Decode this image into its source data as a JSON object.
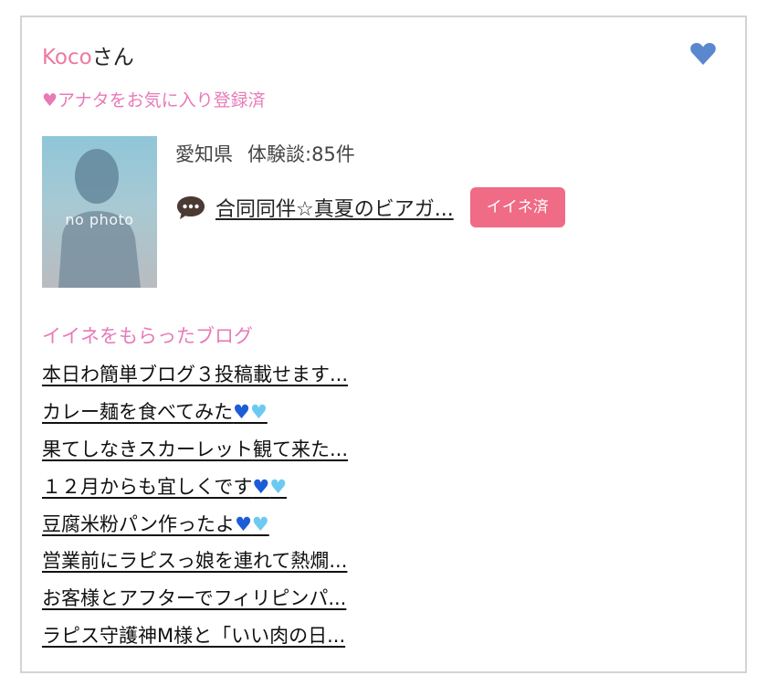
{
  "user": {
    "name": "Koco",
    "honorific": "さん",
    "favorite_status": "♥アナタをお気に入り登録済",
    "avatar_label": "no photo",
    "prefecture": "愛知県",
    "reviews": "体験談:85件"
  },
  "story": {
    "title": "合同同伴☆真夏のビアガ...",
    "like_badge": "イイネ済"
  },
  "blogs": {
    "heading": "イイネをもらったブログ",
    "items": [
      {
        "text": "本日わ簡単ブログ３投稿載せます...",
        "hearts": false
      },
      {
        "text": "カレー麺を食べてみた",
        "hearts": true
      },
      {
        "text": "果てしなきスカーレット観て来た...",
        "hearts": false
      },
      {
        "text": "１２月からも宜しくです",
        "hearts": true
      },
      {
        "text": "豆腐米粉パン作ったよ",
        "hearts": true
      },
      {
        "text": "営業前にラピスっ娘を連れて熱燗...",
        "hearts": false
      },
      {
        "text": "お客様とアフターでフィリピンパ...",
        "hearts": false
      },
      {
        "text": "ラピス守護神M様と「いい肉の日...",
        "hearts": false
      }
    ]
  },
  "colors": {
    "accent_pink": "#ec7aa0",
    "heading_pink": "#e87ab8",
    "badge_pink": "#f06b86",
    "fav_heart_blue": "#5b87cf",
    "heart_blue": "#1c5cd6",
    "heart_light_blue": "#6ccaf0"
  },
  "icons": {
    "favorite": "heart-icon",
    "story": "speech-bubble-icon",
    "blog_hearts": [
      "blue-heart-icon",
      "light-blue-heart-icon"
    ]
  }
}
